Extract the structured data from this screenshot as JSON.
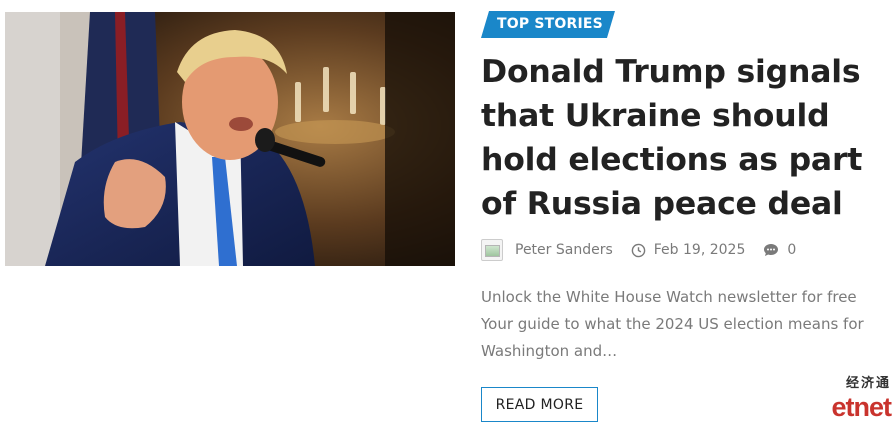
{
  "article": {
    "category": "TOP STORIES",
    "headline": "Donald Trump signals that Ukraine should hold elections as part of Russia peace deal",
    "author": "Peter Sanders",
    "date": "Feb 19, 2025",
    "comments": "0",
    "excerpt": "Unlock the White House Watch newsletter for free Your guide to what the 2024 US election means for Washington and…",
    "read_more": "READ MORE",
    "image_alt": "Donald Trump speaking at a microphone"
  },
  "watermark": {
    "chinese": "经济通",
    "english": "etnet"
  },
  "colors": {
    "accent": "#1a87c9",
    "logo_red": "#c9332d",
    "meta_gray": "#7a7a7a"
  },
  "icons": {
    "author": "avatar",
    "date": "clock-icon",
    "comments": "comment-icon"
  }
}
